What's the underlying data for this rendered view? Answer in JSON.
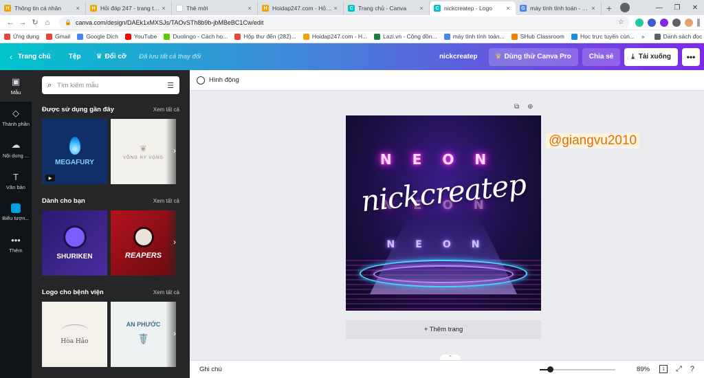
{
  "browser": {
    "tabs": [
      {
        "title": "Thông tin cá nhân",
        "favicon_color": "#f0a500",
        "favicon_letter": "H"
      },
      {
        "title": "Hỏi đáp 247 - trang tra lời",
        "favicon_color": "#f0a500",
        "favicon_letter": "H"
      },
      {
        "title": "Thẻ mới",
        "favicon_color": "#ffffff",
        "favicon_letter": ""
      },
      {
        "title": "Hoidap247.com - Hỏi đáp",
        "favicon_color": "#f0a500",
        "favicon_letter": "H"
      },
      {
        "title": "Trang chủ - Canva",
        "favicon_color": "#00c4cc",
        "favicon_letter": "C"
      },
      {
        "title": "nickcreatep - Logo",
        "favicon_color": "#00c4cc",
        "favicon_letter": "C"
      },
      {
        "title": "máy tính tính toán - Tìm",
        "favicon_color": "#4285f4",
        "favicon_letter": "G"
      }
    ],
    "active_tab_index": 5,
    "url": "canva.com/design/DAEk1xMXSJs/TAOvSTh8b9b-jbMBeBC1Cw/edit",
    "bookmarks": [
      {
        "label": "Ứng dụng",
        "color": "#e8453c"
      },
      {
        "label": "Gmail",
        "color": "#ea4335"
      },
      {
        "label": "Google Dịch",
        "color": "#4285f4"
      },
      {
        "label": "YouTube",
        "color": "#ff0000"
      },
      {
        "label": "Duolingo - Cách họ...",
        "color": "#58cc02"
      },
      {
        "label": "Hộp thư đến (282)...",
        "color": "#ea4335"
      },
      {
        "label": "Hoidap247.com - H...",
        "color": "#f0a500"
      },
      {
        "label": "Lazi.vn - Cộng đồn...",
        "color": "#1a7f3c"
      },
      {
        "label": "máy tính tính toán...",
        "color": "#4285f4"
      },
      {
        "label": "SHub Classroom",
        "color": "#f57c00"
      },
      {
        "label": "Học trực tuyến cùn...",
        "color": "#1e88e5"
      }
    ],
    "bookmarks_more": "»",
    "reading_list": "Danh sách đọc"
  },
  "topbar": {
    "home": "Trang chủ",
    "file": "Tệp",
    "resize": "Đổi cỡ",
    "saved_status": "Đã lưu tất cả thay đổi",
    "design_name": "nickcreatep",
    "try_pro": "Dùng thử Canva Pro",
    "share": "Chia sẻ",
    "download": "Tải xuống",
    "more": "•••"
  },
  "rail": [
    {
      "label": "Mẫu",
      "icon": "template-icon",
      "glyph": "▣",
      "active": true
    },
    {
      "label": "Thành phần",
      "icon": "elements-icon",
      "glyph": "◇",
      "active": false
    },
    {
      "label": "Nội dung ...",
      "icon": "upload-icon",
      "glyph": "☁",
      "active": false
    },
    {
      "label": "Văn bản",
      "icon": "text-icon",
      "glyph": "T",
      "active": false
    },
    {
      "label": "Biểu tượn...",
      "icon": "brand-icon",
      "glyph": "",
      "active": false
    },
    {
      "label": "Thêm",
      "icon": "more-icon",
      "glyph": "•••",
      "active": false
    }
  ],
  "panel": {
    "search_placeholder": "Tìm kiếm mẫu",
    "sections": [
      {
        "title": "Được sử dụng gần đây",
        "see_all": "Xem tất cả",
        "items": [
          {
            "name": "MEGAFURY",
            "style": "mega"
          },
          {
            "name": "VÕNG HY VỌNG",
            "style": "vong"
          }
        ]
      },
      {
        "title": "Dành cho bạn",
        "see_all": "Xem tất cả",
        "items": [
          {
            "name": "SHURIKEN",
            "style": "shur"
          },
          {
            "name": "REAPERS",
            "style": "reap"
          }
        ]
      },
      {
        "title": "Logo cho bệnh viện",
        "see_all": "Xem tất cả",
        "items": [
          {
            "name": "Hòa Hảo",
            "style": "hoa"
          },
          {
            "name": "AN PHƯỚC",
            "style": "anp"
          }
        ]
      }
    ]
  },
  "editor": {
    "animate": "Hình động",
    "design_neon_top": "NEON",
    "design_script": "nickcreatep",
    "design_neon_mid": "NEON",
    "design_neon_bottom": "NEON",
    "watermark": "@giangvu2010",
    "add_page": "+ Thêm trang"
  },
  "bottombar": {
    "notes": "Ghi chú",
    "zoom_value": "89%",
    "zoom_fraction": 0.14,
    "page_count": "1"
  }
}
